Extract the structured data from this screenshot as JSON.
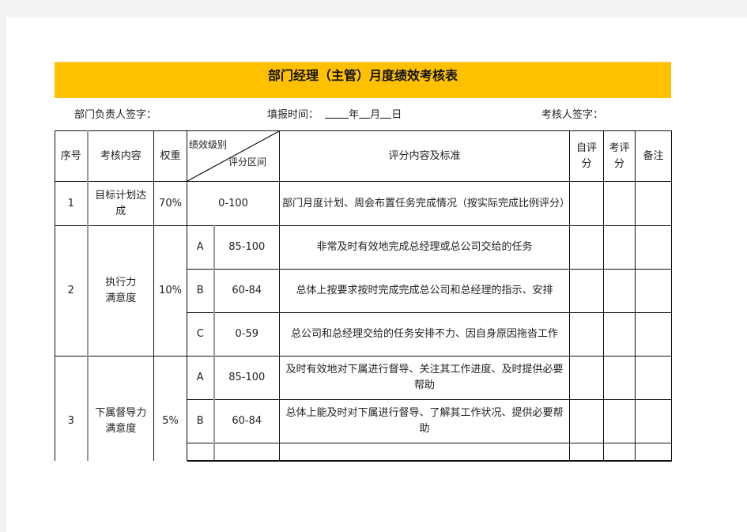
{
  "title": "部门经理（主管）月度绩效考核表",
  "signature_line": {
    "dept_head_label": "部门负责人签字：",
    "fill_time_label": "填报时间：",
    "year": "年",
    "month": "月",
    "day": "日",
    "reviewer_label": "考核人签字："
  },
  "colors": {
    "banner": "#FFC000",
    "border": "#111111",
    "background": "#ffffff"
  },
  "table": {
    "headers": {
      "no": "序号",
      "item": "考核内容",
      "weight": "权重",
      "diag_top": "绩效级别",
      "diag_bottom": "评分区间",
      "standard": "评分内容及标准",
      "self_score": "自评分",
      "review_score": "考评分",
      "remark": "备注"
    },
    "rows": [
      {
        "no": "1",
        "item": "目标计划达成",
        "weight": "70%",
        "range": "0-100",
        "standard": "部门月度计划、周会布置任务完成情况（按实际完成比例评分）"
      },
      {
        "no": "2",
        "item": "执行力满意度",
        "weight": "10%",
        "levels": [
          {
            "grade": "A",
            "range": "85-100",
            "standard": "非常及时有效地完成总经理或总公司交给的任务"
          },
          {
            "grade": "B",
            "range": "60-84",
            "standard": "总体上按要求按时完成完成总公司和总经理的指示、安排"
          },
          {
            "grade": "C",
            "range": "0-59",
            "standard": "总公司和总经理交给的任务安排不力、因自身原因拖沓工作"
          }
        ]
      },
      {
        "no": "3",
        "item": "下属督导力满意度",
        "weight": "5%",
        "levels": [
          {
            "grade": "A",
            "range": "85-100",
            "standard": "及时有效地对下属进行督导、关注其工作进度、及时提供必要帮助"
          },
          {
            "grade": "B",
            "range": "60-84",
            "standard": "总体上能及时对下属进行督导、了解其工作状况、提供必要帮助"
          }
        ]
      }
    ]
  }
}
